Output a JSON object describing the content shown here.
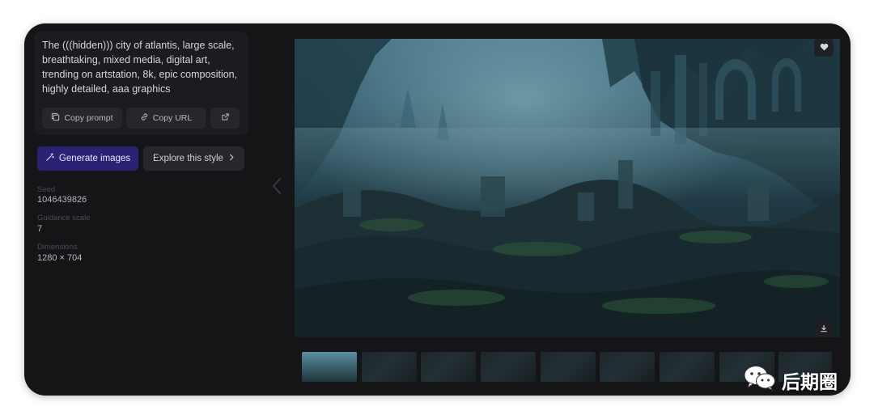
{
  "prompt": {
    "text": "The (((hidden))) city of atlantis, large scale, breathtaking, mixed media, digital art, trending on artstation, 8k, epic composition, highly detailed, aaa graphics",
    "copy_prompt_label": "Copy prompt",
    "copy_url_label": "Copy URL"
  },
  "actions": {
    "generate_label": "Generate images",
    "explore_label": "Explore this style"
  },
  "meta": {
    "seed_label": "Seed",
    "seed_value": "1046439826",
    "guidance_label": "Guidance scale",
    "guidance_value": "7",
    "dimensions_label": "Dimensions",
    "dimensions_value": "1280 × 704"
  },
  "thumbnails": {
    "count": 9,
    "active_index": 0
  },
  "watermark": {
    "text": "后期圈"
  },
  "colors": {
    "card_bg": "#151518",
    "primary_button": "#2a2373",
    "secondary_button": "#26262b"
  },
  "icons": [
    "copy-icon",
    "link-icon",
    "external-link-icon",
    "magic-wand-icon",
    "chevron-right-icon",
    "chevron-left-icon",
    "heart-icon",
    "download-icon",
    "wechat-icon"
  ]
}
